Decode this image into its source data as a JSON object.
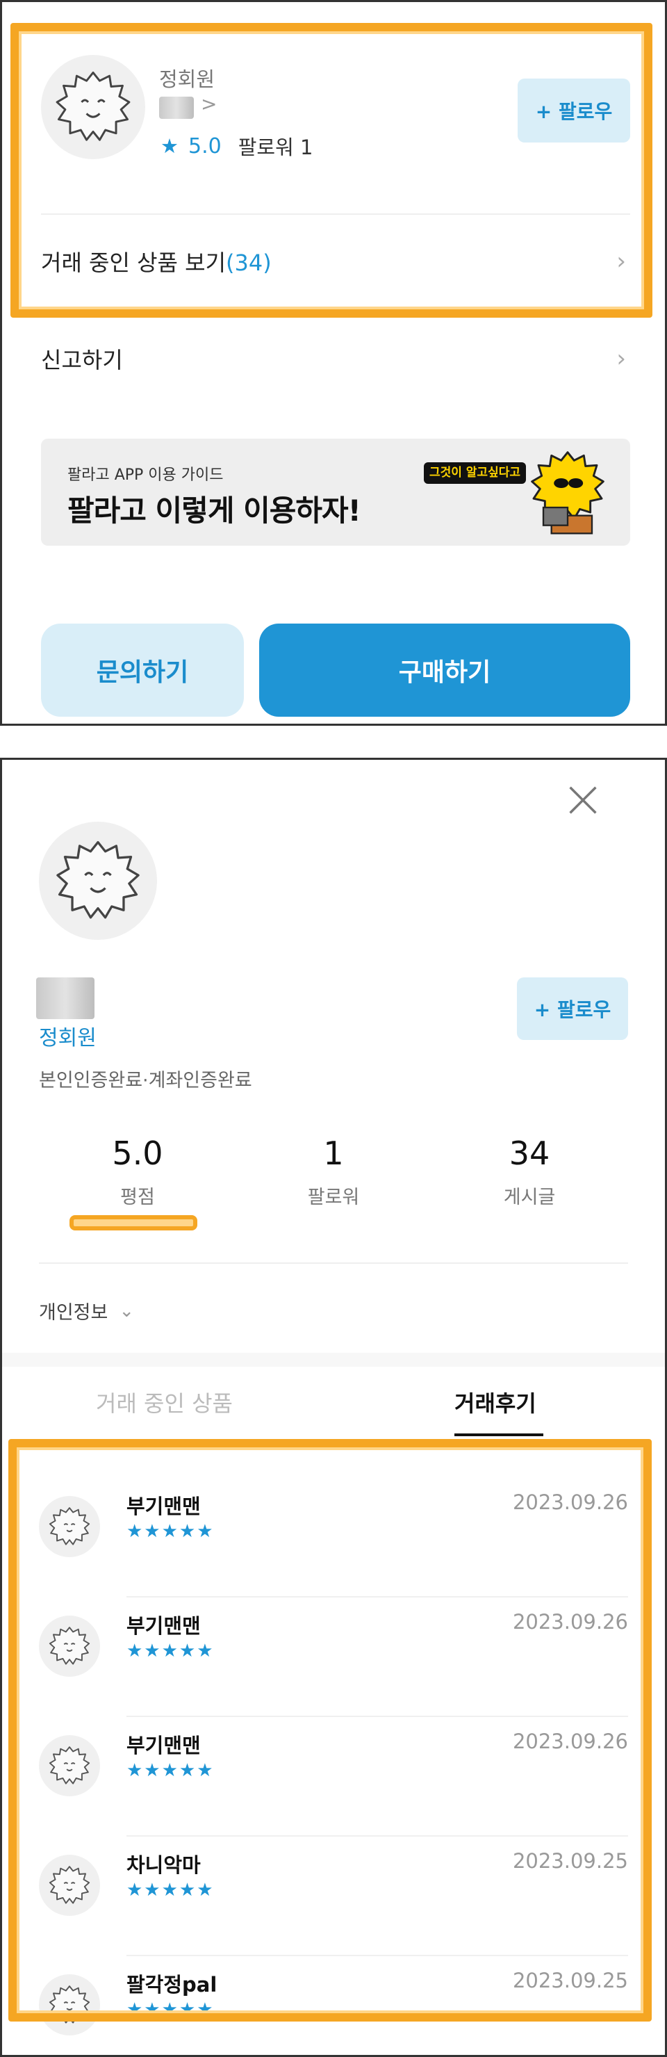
{
  "top_card": {
    "seller_name": "정회원",
    "rating_star": "★",
    "rating": "5.0",
    "follower_text": "팔로워 1",
    "follow_button": "+ 팔로우",
    "products_label": "거래 중인 상품 보기",
    "products_count": "(34)",
    "report_label": "신고하기",
    "chevron": "›",
    "small_chevron": ">"
  },
  "banner": {
    "subtitle": "팔라고 APP 이용 가이드",
    "title": "팔라고 이렇게 이용하자!",
    "tag": "그것이 알고싶다고"
  },
  "actions": {
    "inquiry": "문의하기",
    "buy": "구매하기"
  },
  "profile": {
    "name": "정회원",
    "verification": "본인인증완료·계좌인증완료",
    "follow_button": "+ 팔로우",
    "stats": [
      {
        "value": "5.0",
        "label": "평점"
      },
      {
        "value": "1",
        "label": "팔로워"
      },
      {
        "value": "34",
        "label": "게시글"
      }
    ],
    "private_info": "개인정보",
    "private_chevron": "⌄"
  },
  "tabs": {
    "products": "거래 중인 상품",
    "reviews": "거래후기"
  },
  "reviews": [
    {
      "name": "부기맨맨",
      "stars": "★★★★★",
      "date": "2023.09.26"
    },
    {
      "name": "부기맨맨",
      "stars": "★★★★★",
      "date": "2023.09.26"
    },
    {
      "name": "부기맨맨",
      "stars": "★★★★★",
      "date": "2023.09.26"
    },
    {
      "name": "차니악마",
      "stars": "★★★★★",
      "date": "2023.09.25"
    },
    {
      "name": "팔각정pal",
      "stars": "★★★★★",
      "date": "2023.09.25"
    }
  ],
  "colors": {
    "accent": "#1f95d5",
    "accent_light": "#d9eef8",
    "highlight": "#f5a623",
    "banner_bg": "#eeeeee"
  },
  "icons": {
    "avatar": "fluffy-mascot-icon",
    "close": "close-icon",
    "star": "star-icon"
  }
}
